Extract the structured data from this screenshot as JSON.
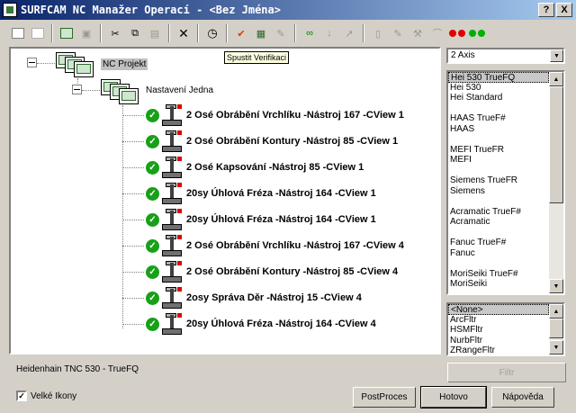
{
  "window": {
    "title": "SURFCAM NC Manažer Operací - <Bez Jména>",
    "help_label": "?",
    "close_label": "X"
  },
  "toolbar": {
    "icons": [
      "expand-all-icon",
      "collapse-all-icon",
      "op-group-icon",
      "op-disabled-icon",
      "cut-icon",
      "copy-icon",
      "paste-icon",
      "delete-icon",
      "clock-icon",
      "verify-icon",
      "post-icon",
      "edit-icon",
      "toolpath-icon",
      "plunge-icon",
      "transform-icon",
      "doc-icon",
      "edit-doc-icon",
      "tool-icon",
      "paint-icon",
      "red-dots-icon",
      "green-dots-icon"
    ]
  },
  "tooltip": {
    "text": "Spustit Verifikaci"
  },
  "tree": {
    "project_label": "NC Projekt",
    "setup_label": "Nastavení Jedna",
    "operations": [
      "2 Osé Obrábění Vrchlíku  -Nástroj 167 -CView 1",
      "2 Osé Obrábění Kontury  -Nástroj 85 -CView 1",
      "2 Osé Kapsování  -Nástroj 85 -CView 1",
      "20sy Úhlová Fréza  -Nástroj 164 -CView 1",
      "20sy Úhlová Fréza  -Nástroj 164 -CView 1",
      "2 Osé Obrábění Vrchlíku  -Nástroj 167 -CView 4",
      "2 Osé Obrábění Kontury  -Nástroj 85 -CView 4",
      "2osy Správa Děr  -Nástroj 15 -CView 4",
      "20sy Úhlová Fréza  -Nástroj 164 -CView 4"
    ]
  },
  "axis_combo": {
    "value": "2 Axis"
  },
  "post_list": {
    "items": [
      "Hei 530 TrueFQ",
      "Hei 530",
      "Hei Standard",
      "",
      "HAAS TrueF#",
      "HAAS",
      "",
      "MEFI TrueFR",
      "MEFI",
      "",
      "Siemens TrueFR",
      "Siemens",
      "",
      "Acramatic TrueF#",
      "Acramatic",
      "",
      "Fanuc TrueF#",
      "Fanuc",
      "",
      "MoriSeiki TrueF#",
      "MoriSeiki"
    ],
    "selected": "Hei 530 TrueFQ"
  },
  "filter_list": {
    "items": [
      "<None>",
      "ArcFltr",
      "HSMFltr",
      "NurbFltr",
      "ZRangeFltr"
    ],
    "selected": "<None>"
  },
  "status": {
    "post_name": "Heidenhain TNC 530 - TrueFQ"
  },
  "footer": {
    "filter_button": "Filtr",
    "large_icons_label": "Velké Ikony",
    "large_icons_checked": true,
    "postproc_button": "PostProces",
    "done_button": "Hotovo",
    "help_button": "Nápověda"
  }
}
